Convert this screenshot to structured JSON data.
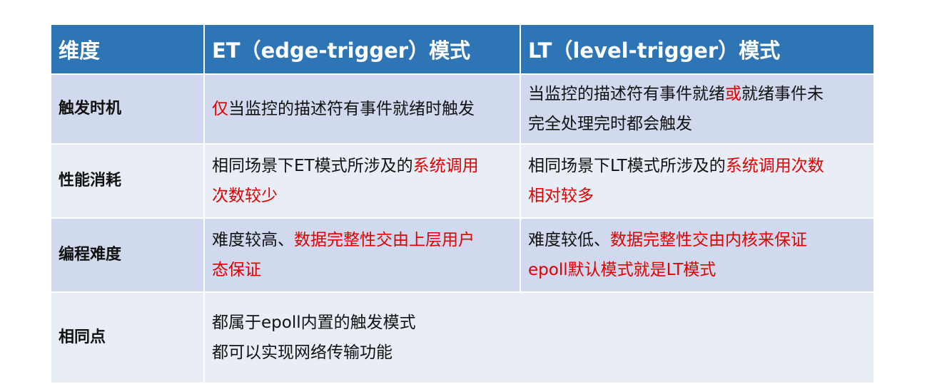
{
  "header": {
    "col0": "维度",
    "col1": "ET（edge-trigger）模式",
    "col2": "LT（level-trigger）模式"
  },
  "rows": [
    {
      "label": "触发时机",
      "et": {
        "line1_red": "仅",
        "line1_rest": "当监控的描述符有事件就绪时触发"
      },
      "lt": {
        "line1_a": "当监控的描述符有事件就绪",
        "line1_red": "或",
        "line1_b": "就绪事件未",
        "line2": "完全处理完时都会触发"
      }
    },
    {
      "label": "性能消耗",
      "et": {
        "line1_a": "相同场景下ET模式所涉及的",
        "line1_red": "系统调用",
        "line2_red": "次数较少"
      },
      "lt": {
        "line1_a": "相同场景下LT模式所涉及的",
        "line1_red": "系统调用次数",
        "line2_red": "相对较多"
      }
    },
    {
      "label": "编程难度",
      "et": {
        "line1_a": "难度较高、",
        "line1_red": "数据完整性交由上层用户",
        "line2_red": "态保证"
      },
      "lt": {
        "line1_a": "难度较低、",
        "line1_red": "数据完整性交由内核来保证",
        "line2_red": "epoll默认模式就是LT模式"
      }
    },
    {
      "label": "相同点",
      "common": {
        "line1": "都属于epoll内置的触发模式",
        "line2": "都可以实现网络传输功能"
      }
    }
  ],
  "colors": {
    "header_bg": "#2e75b6",
    "row_dark": "#d1d9ee",
    "row_light": "#e9edf6",
    "highlight": "#e00000"
  }
}
